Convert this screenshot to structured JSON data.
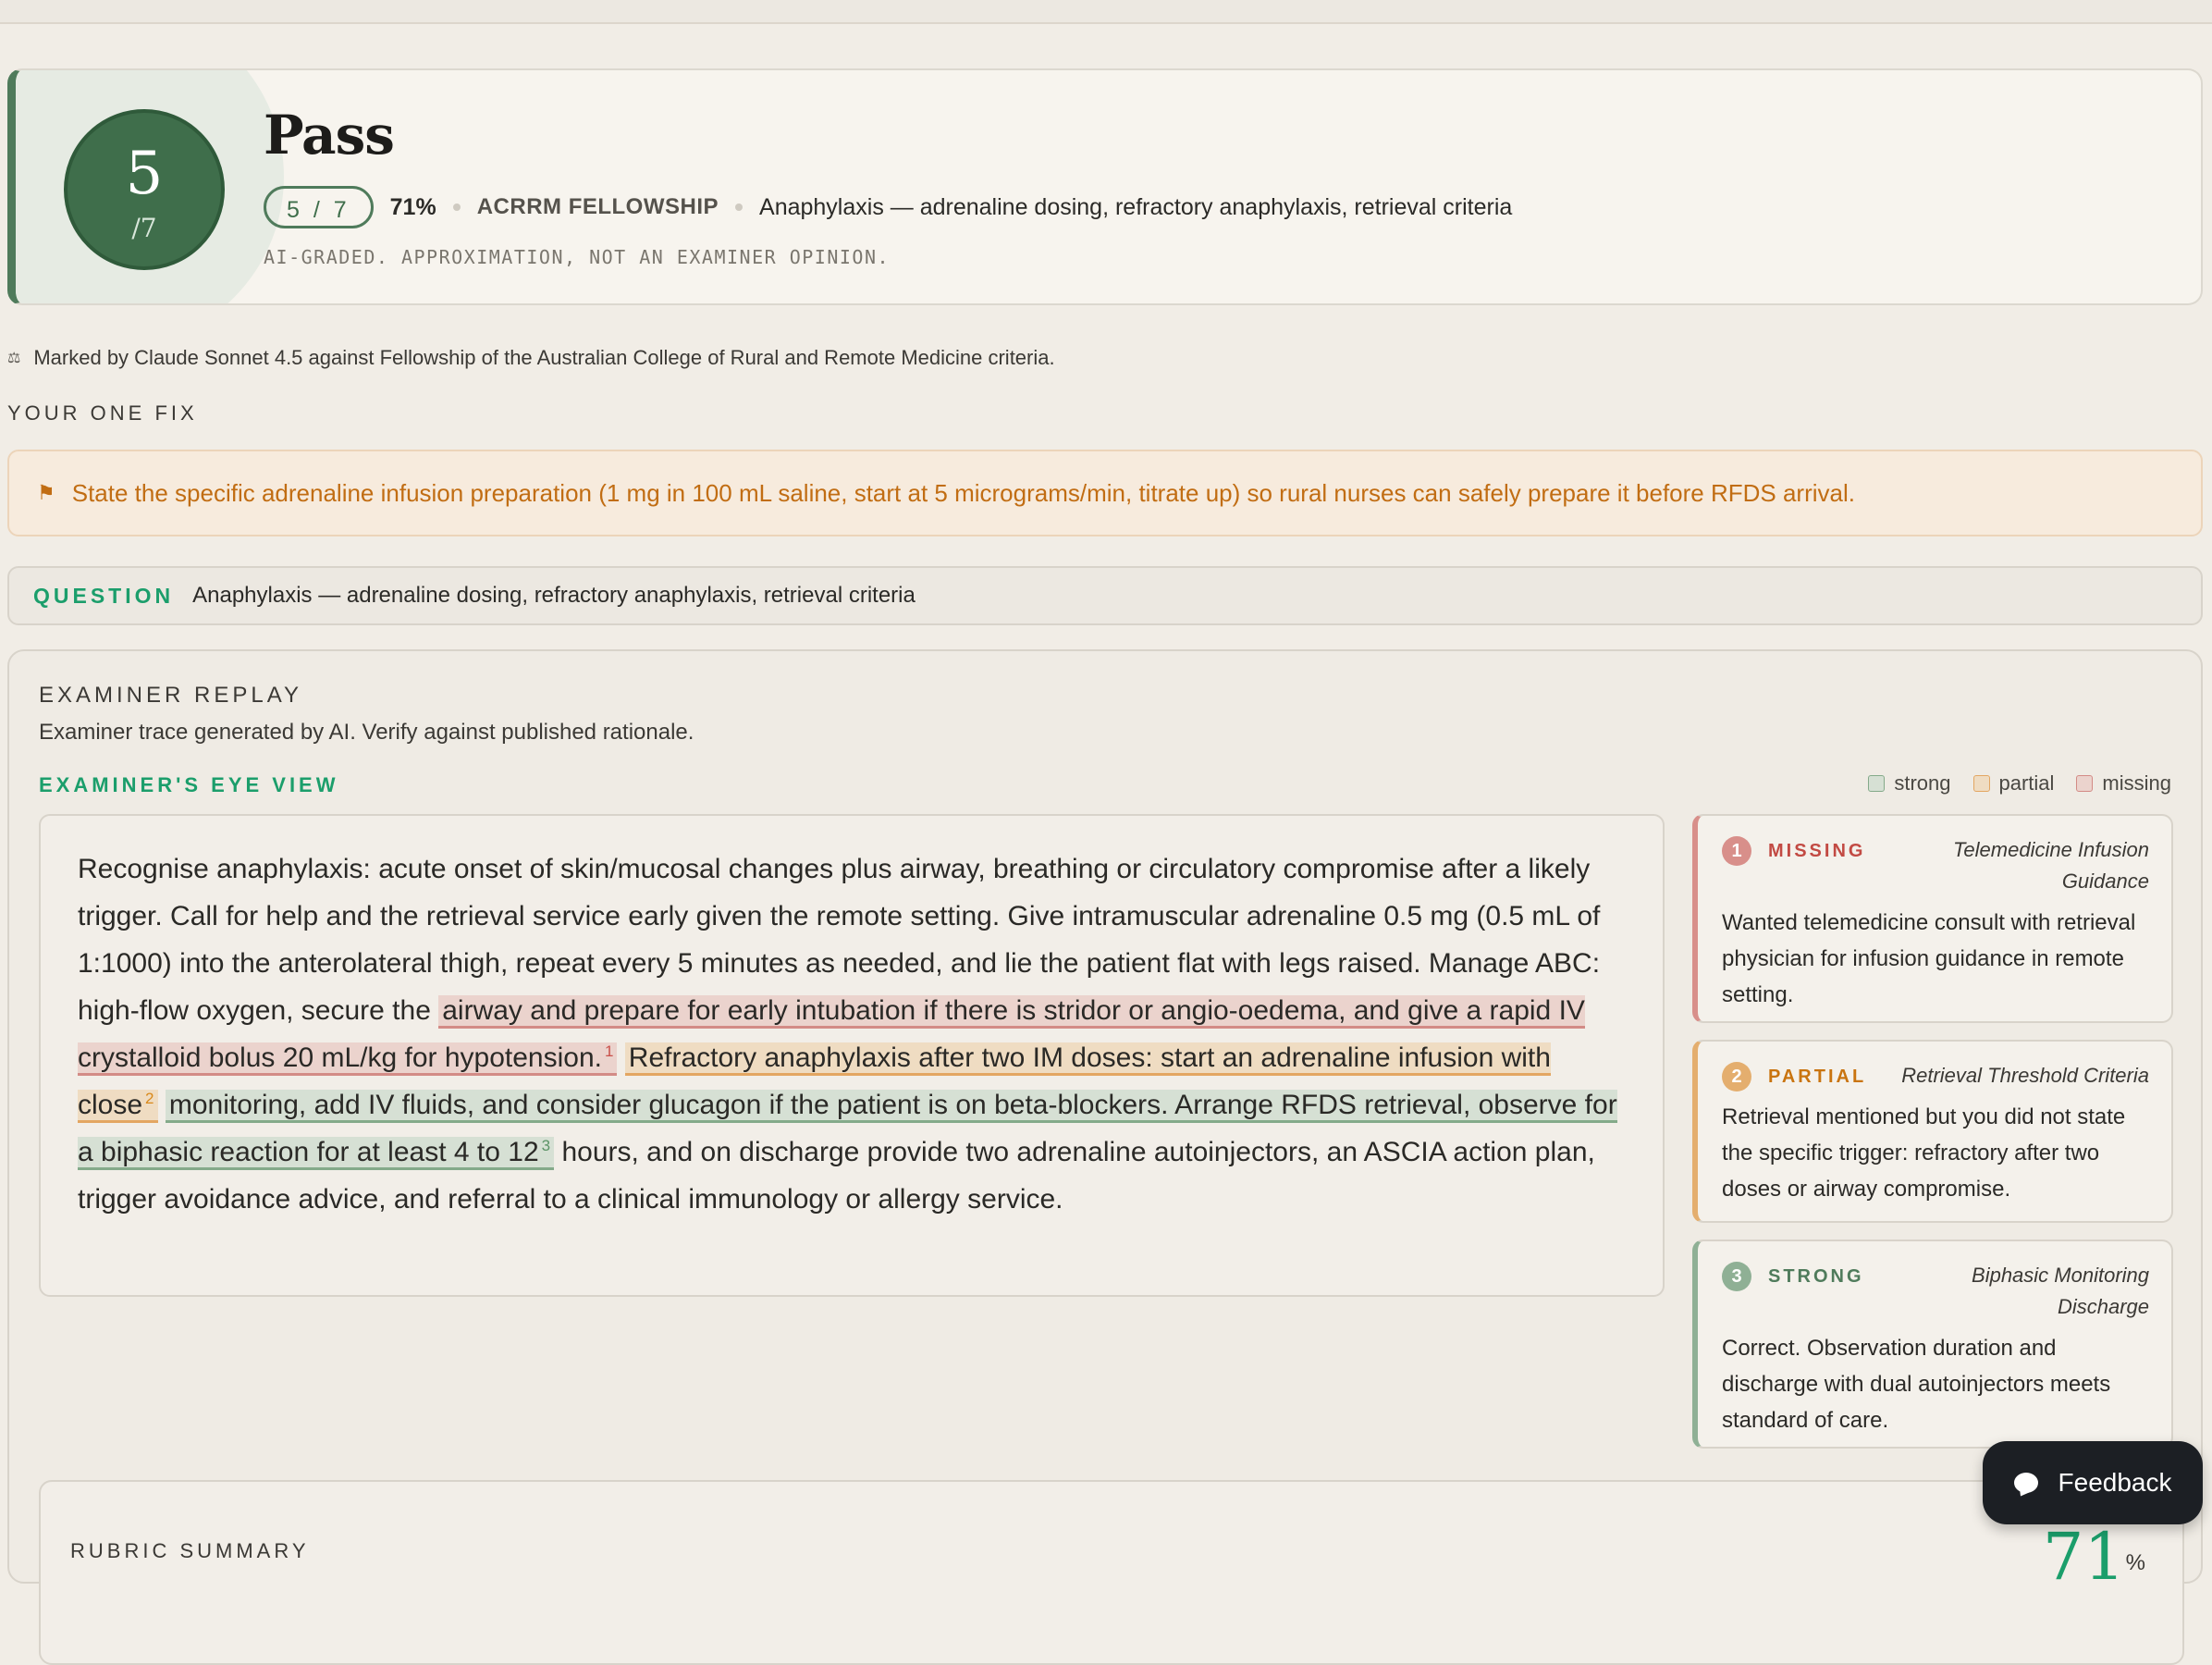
{
  "score": {
    "value": "5",
    "denominator": "/7",
    "result": "Pass",
    "pill": "5 / 7",
    "percent": "71%",
    "program": "ACRRM FELLOWSHIP",
    "topic": "Anaphylaxis — adrenaline dosing, refractory anaphylaxis, retrieval criteria",
    "disclaimer": "AI-GRADED. APPROXIMATION, NOT AN EXAMINER OPINION."
  },
  "marked_by": "Marked by Claude Sonnet 4.5 against Fellowship of the Australian College of Rural and Remote Medicine criteria.",
  "one_fix": {
    "label": "YOUR ONE FIX",
    "text": "State the specific adrenaline infusion preparation (1 mg in 100 mL saline, start at 5 micrograms/min, titrate up) so rural nurses can safely prepare it before RFDS arrival."
  },
  "question": {
    "label": "QUESTION",
    "text": "Anaphylaxis — adrenaline dosing, refractory anaphylaxis, retrieval criteria"
  },
  "replay": {
    "title": "EXAMINER REPLAY",
    "subtitle": "Examiner trace generated by AI. Verify against published rationale.",
    "eye_label": "EXAMINER'S EYE VIEW",
    "legend": {
      "strong": "strong",
      "partial": "partial",
      "missing": "missing"
    },
    "colors": {
      "strong": "#d6e0d4",
      "partial": "#efdcc2",
      "missing": "#ebd3cd"
    },
    "answer": {
      "plain1": "Recognise anaphylaxis: acute onset of skin/mucosal changes plus airway, breathing or circulatory compromise after a likely trigger. Call for help and the retrieval service early given the remote setting. Give intramuscular adrenaline 0.5 mg (0.5 mL of 1:1000) into the anterolateral thigh, repeat every 5 minutes as needed, and lie the patient flat with legs raised. Manage ABC: high-flow oxygen, secure the",
      "missing": "airway and prepare for early intubation if there is stridor or angio-oedema, and give a rapid IV crystalloid bolus 20 mL/kg for hypotension.",
      "fn1": "1",
      "partial": "Refractory anaphylaxis after two IM doses: start an adrenaline infusion with close",
      "fn2": "2",
      "strong": "monitoring, add IV fluids, and consider glucagon if the patient is on beta-blockers. Arrange RFDS retrieval, observe for a biphasic reaction for at least 4 to 12",
      "fn3": "3",
      "plain2": "hours, and on discharge provide two adrenaline autoinjectors, an ASCIA action plan, trigger avoidance advice, and referral to a clinical immunology or allergy service."
    },
    "criteria": [
      {
        "num": "1",
        "status": "MISSING",
        "name": "Telemedicine Infusion Guidance",
        "body": "Wanted telemedicine consult with retrieval physician for infusion guidance in remote setting."
      },
      {
        "num": "2",
        "status": "PARTIAL",
        "name": "Retrieval Threshold Criteria",
        "body": "Retrieval mentioned but you did not state the specific trigger: refractory after two doses or airway compromise."
      },
      {
        "num": "3",
        "status": "STRONG",
        "name": "Biphasic Monitoring Discharge",
        "body": "Correct. Observation duration and discharge with dual autoinjectors meets standard of care."
      }
    ]
  },
  "rubric": {
    "title": "RUBRIC SUMMARY",
    "percent": "71",
    "percent_sign": "%"
  },
  "feedback_label": "Feedback"
}
